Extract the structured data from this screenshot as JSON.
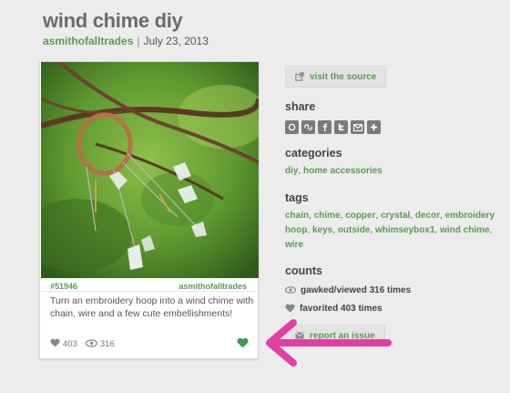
{
  "post": {
    "title": "wind chime diy",
    "author": "asmithofalltrades",
    "separator": "|",
    "date": "July 23, 2013"
  },
  "card": {
    "id": "#51946",
    "author": "asmithofalltrades",
    "description": "Turn an embroidery hoop into a wind chime with chain, wire and a few cute embellishments!",
    "likes": "403",
    "views": "316"
  },
  "sidebar": {
    "source_button": "visit the source",
    "share_heading": "share",
    "share_icons": [
      "pinterest-icon",
      "stumbleupon-icon",
      "facebook-icon",
      "twitter-icon",
      "email-icon",
      "plus-icon"
    ],
    "categories_heading": "categories",
    "categories": [
      "diy",
      "home accessories"
    ],
    "tags_heading": "tags",
    "tags": [
      "chain",
      "chime",
      "copper",
      "crystal",
      "decor",
      "embroidery hoop",
      "keys",
      "outside",
      "whimseybox1",
      "wind chime",
      "wire"
    ],
    "counts_heading": "counts",
    "gawked": "gawked/viewed 316 times",
    "favorited": "favorited 403 times",
    "report_button": "report an issue"
  },
  "colors": {
    "accent_green": "#5b9a53",
    "annotation_arrow": "#e040a0"
  }
}
